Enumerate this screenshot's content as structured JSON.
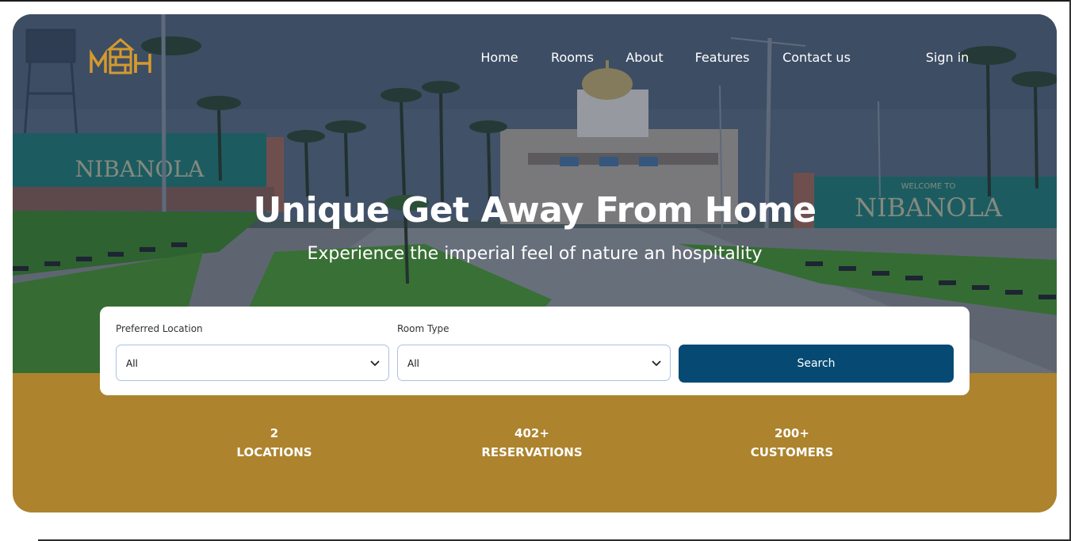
{
  "brand": {
    "logo_text": "MEH",
    "accent_color": "#d59a2d"
  },
  "nav": {
    "links": [
      "Home",
      "Rooms",
      "About",
      "Features",
      "Contact us"
    ],
    "sign_in": "Sign in"
  },
  "hero": {
    "title": "Unique Get Away From Home",
    "subtitle": "Experience the imperial feel of nature an hospitality",
    "sign_left": "NIBANOLA",
    "sign_right": "NIBANOLA",
    "sign_right_top": "WELCOME TO"
  },
  "search": {
    "location_label": "Preferred Location",
    "location_value": "All",
    "room_type_label": "Room Type",
    "room_type_value": "All",
    "button_label": "Search",
    "button_color": "#064a74"
  },
  "stats": [
    {
      "number": "2",
      "label": "LOCATIONS"
    },
    {
      "number": "402+",
      "label": "RESERVATIONS"
    },
    {
      "number": "200+",
      "label": "CUSTOMERS"
    }
  ],
  "colors": {
    "stats_band": "#ad832d",
    "field_border": "#a9c3e3"
  }
}
